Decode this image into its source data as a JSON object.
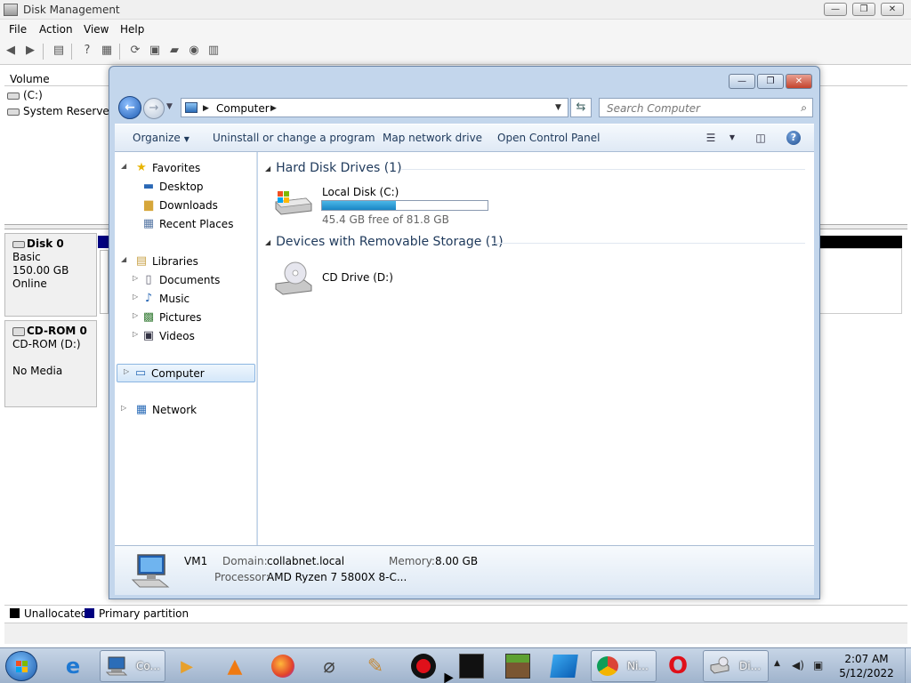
{
  "disk_management": {
    "title": "Disk Management",
    "menu": [
      "File",
      "Action",
      "View",
      "Help"
    ],
    "volume_header": "Volume",
    "volumes": [
      "(C:)",
      "System Reserved"
    ],
    "disks": [
      {
        "name": "Disk 0",
        "type": "Basic",
        "size": "150.00 GB",
        "status": "Online"
      },
      {
        "name": "CD-ROM 0",
        "type": "CD-ROM (D:)",
        "size": "",
        "status": "No Media"
      }
    ],
    "legend": [
      {
        "label": "Unallocated",
        "color": "#000000"
      },
      {
        "label": "Primary partition",
        "color": "#000080"
      }
    ]
  },
  "explorer": {
    "address": "Computer",
    "search_placeholder": "Search Computer",
    "commands": [
      "Organize",
      "Uninstall or change a program",
      "Map network drive",
      "Open Control Panel"
    ],
    "nav": {
      "favorites": "Favorites",
      "favorites_items": [
        "Desktop",
        "Downloads",
        "Recent Places"
      ],
      "libraries": "Libraries",
      "libraries_items": [
        "Documents",
        "Music",
        "Pictures",
        "Videos"
      ],
      "computer": "Computer",
      "network": "Network"
    },
    "groups": [
      {
        "title": "Hard Disk Drives (1)",
        "drive": "Local Disk (C:)",
        "free_text": "45.4 GB free of 81.8 GB",
        "used_fraction": 0.445
      },
      {
        "title": "Devices with Removable Storage (1)",
        "drive": "CD Drive (D:)"
      }
    ],
    "details": {
      "name": "VM1",
      "domain_label": "Domain:",
      "domain": "collabnet.local",
      "memory_label": "Memory:",
      "memory": "8.00 GB",
      "processor_label": "Processor:",
      "processor": "AMD Ryzen 7 5800X 8-C..."
    }
  },
  "taskbar": {
    "buttons": [
      {
        "label": "Co...",
        "icon": "computer-icon"
      },
      {
        "label": "Ni...",
        "icon": "chrome-icon"
      },
      {
        "label": "Di...",
        "icon": "disk-management-icon"
      }
    ],
    "time": "2:07 AM",
    "date": "5/12/2022"
  }
}
